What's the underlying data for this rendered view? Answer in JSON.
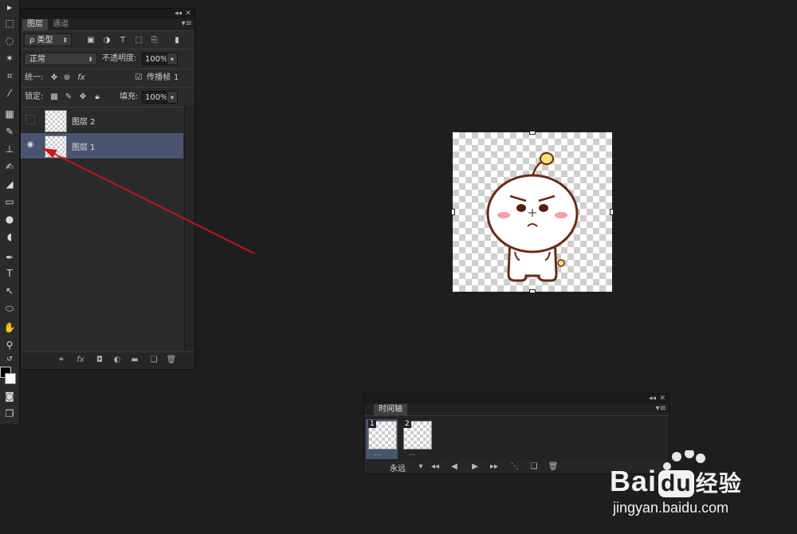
{
  "layers_panel": {
    "tabs": [
      "图层",
      "通道"
    ],
    "filter_label": "ρ 类型",
    "blend_mode": "正常",
    "opacity_label": "不透明度:",
    "opacity_value": "100%",
    "unify_label": "统一:",
    "propagate_label": "传播帧",
    "propagate_value": "1",
    "lock_label": "锁定:",
    "fill_label": "填充:",
    "fill_value": "100%",
    "layers": [
      {
        "name": "图层 2",
        "visible": false,
        "selected": false
      },
      {
        "name": "图层 1",
        "visible": true,
        "selected": true
      }
    ],
    "bottom_icons": [
      "link-icon",
      "fx-icon",
      "mask-icon",
      "adjustment-icon",
      "folder-icon",
      "new-layer-icon",
      "trash-icon"
    ]
  },
  "timeline_panel": {
    "tab": "时间轴",
    "frames": [
      {
        "number": "1",
        "delay": "...",
        "selected": true
      },
      {
        "number": "2",
        "delay": "...",
        "selected": false
      }
    ],
    "loop": "永远"
  },
  "watermark": {
    "brand": "Bai",
    "brand2": "du",
    "brand_cn": "经验",
    "url": "jingyan.baidu.com"
  },
  "colors": {
    "selection": "#4a5470",
    "arrow": "#cc1111",
    "panel": "#2b2b2b",
    "background": "#1e1e1e"
  }
}
